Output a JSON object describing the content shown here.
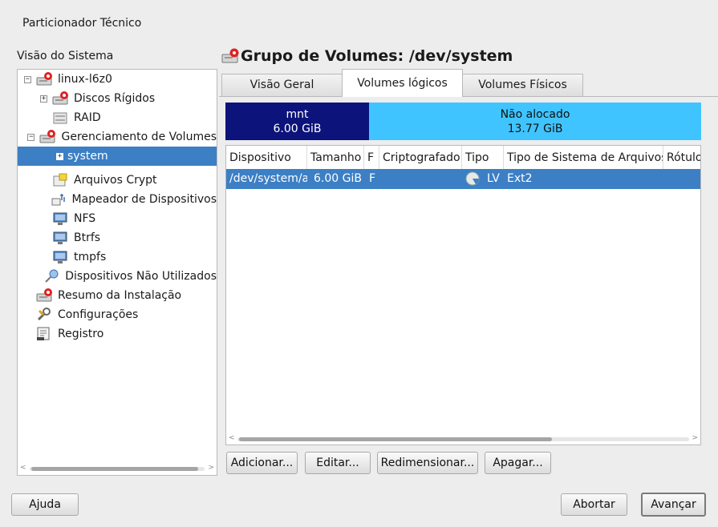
{
  "window": {
    "title": "Particionador Técnico"
  },
  "tree": {
    "label": "Visão do Sistema",
    "items": [
      {
        "label": "linux-l6z0",
        "expander": "−",
        "icon": "hard-disk-icon"
      },
      {
        "label": "Discos Rígidos",
        "expander": "+",
        "icon": "hard-disk-icon"
      },
      {
        "label": "RAID",
        "expander": "",
        "icon": "raid-icon"
      },
      {
        "label": "Gerenciamento de Volumes",
        "expander": "−",
        "icon": "hard-disk-icon"
      },
      {
        "label": "system",
        "expander": "+",
        "icon": "",
        "selected": true
      },
      {
        "label": "Arquivos Crypt",
        "expander": "",
        "icon": "crypt-icon"
      },
      {
        "label": "Mapeador de Dispositivos",
        "expander": "",
        "icon": "device-mapper-icon"
      },
      {
        "label": "NFS",
        "expander": "",
        "icon": "nfs-icon"
      },
      {
        "label": "Btrfs",
        "expander": "",
        "icon": "btrfs-icon"
      },
      {
        "label": "tmpfs",
        "expander": "",
        "icon": "tmpfs-icon"
      },
      {
        "label": "Dispositivos Não Utilizados",
        "expander": "",
        "icon": "unused-devices-icon"
      },
      {
        "label": "Resumo da Instalação",
        "expander": "",
        "icon": "hard-disk-icon"
      },
      {
        "label": "Configurações",
        "expander": "",
        "icon": "settings-icon"
      },
      {
        "label": "Registro",
        "expander": "",
        "icon": "log-icon"
      }
    ]
  },
  "volume_group": {
    "title": "Grupo de Volumes: /dev/system",
    "tabs": [
      "Visão Geral",
      "Volumes lógicos",
      "Volumes Físicos"
    ],
    "active_tab": "Volumes lógicos",
    "usage_bar": [
      {
        "name": "mnt",
        "size": "6.00 GiB",
        "color": "#0c137a"
      },
      {
        "name": "Não alocado",
        "size": "13.77 GiB",
        "color": "#3fc4ff"
      }
    ],
    "table": {
      "columns": [
        "Dispositivo",
        "Tamanho",
        "F",
        "Criptografado",
        "Tipo",
        "Tipo de Sistema de Arquivos",
        "Rótulo"
      ],
      "rows": [
        {
          "device": "/dev/system/a",
          "size": "6.00 GiB",
          "f": "F",
          "encrypted": "",
          "type": "LV",
          "fs_type": "Ext2",
          "label": ""
        }
      ]
    },
    "buttons": {
      "add": "Adicionar...",
      "edit": "Editar...",
      "resize": "Redimensionar...",
      "delete": "Apagar..."
    }
  },
  "footer": {
    "help": "Ajuda",
    "abort": "Abortar",
    "next": "Avançar"
  },
  "colors": {
    "selection": "#3c7fc5",
    "lv_bar": "#0c137a",
    "free_bar": "#3fc4ff"
  }
}
